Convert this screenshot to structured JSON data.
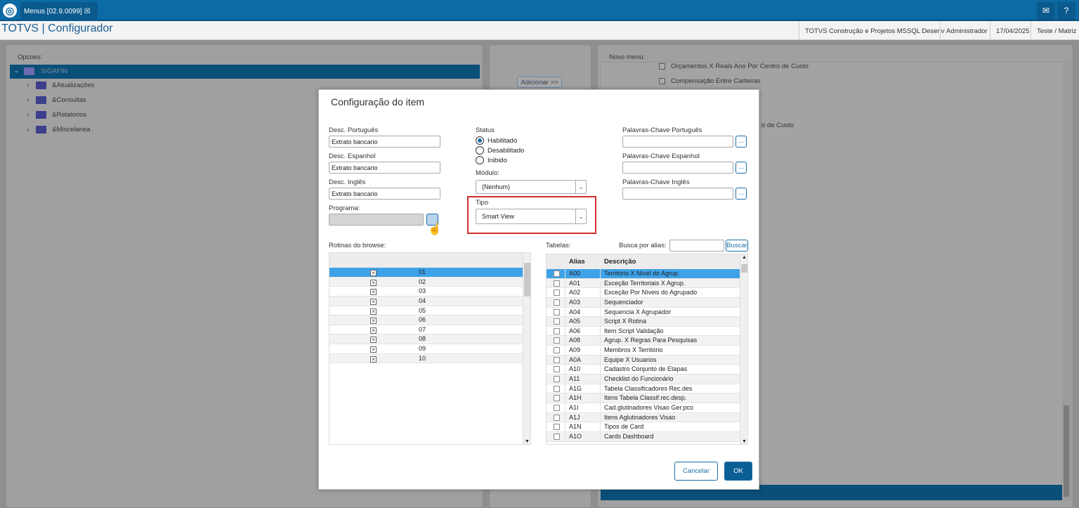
{
  "topbar": {
    "tab_label": "Menus [02.9.0099]",
    "tab_close": "☒",
    "mail_icon": "✉",
    "help_icon": "?"
  },
  "header": {
    "title": "TOTVS | Configurador",
    "environment": "TOTVS Construção e Projetos MSSQL Desenv",
    "user": "Administrador",
    "date": "17/04/2025",
    "branch": "Teste / Matriz"
  },
  "left_panel": {
    "label": "Opcoes:",
    "root": "SIGAFIN",
    "items": [
      "&Atualizações",
      "&Consultas",
      "&Relatorios",
      "&Miscelanea"
    ]
  },
  "middle_panel": {
    "add_button": "Adicionar >>"
  },
  "right_panel": {
    "label": "Novo menu:",
    "items": [
      "Orçamentos X Reais Ano Por Centro de Custo",
      "Compensação Entre Carteiras"
    ],
    "partial_text": "o de Custo"
  },
  "dialog": {
    "title": "Configuração do item",
    "desc_pt_label": "Desc. Português",
    "desc_pt": "Extrato bancario",
    "desc_es_label": "Desc. Espanhol",
    "desc_es": "Extrato bancario",
    "desc_en_label": "Desc. Inglês",
    "desc_en": "Extrato bancario",
    "programa_label": "Programa:",
    "programa": "",
    "status_label": "Status",
    "status_options": [
      "Habilitado",
      "Desabilitado",
      "Inibido"
    ],
    "status_selected": "Habilitado",
    "modulo_label": "Módulo:",
    "modulo": "(Nenhum)",
    "tipo_label": "Tipo",
    "tipo": "Smart View",
    "kw_pt_label": "Palavras-Chave Português",
    "kw_es_label": "Palavras-Chave Espanhol",
    "kw_en_label": "Palavras-Chave Inglês",
    "dots": "...",
    "rotinas_label": "Rotinas do browse:",
    "rotinas": [
      "01",
      "02",
      "03",
      "04",
      "05",
      "06",
      "07",
      "08",
      "09",
      "10"
    ],
    "tabelas_label": "Tabelas:",
    "busca_label": "Busca por alias:",
    "busca_value": "",
    "buscar_button": "Buscar",
    "tabelas_headers": [
      "Alias",
      "Descrição"
    ],
    "tabelas": [
      [
        "A00",
        "Território X Nível do Agrup."
      ],
      [
        "A01",
        "Exceção Territoriais X Agrup."
      ],
      [
        "A02",
        "Exceção Por Níveis do Agrupado"
      ],
      [
        "A03",
        "Sequenciador"
      ],
      [
        "A04",
        "Sequencia X Agrupador"
      ],
      [
        "A05",
        "Script X Rotina"
      ],
      [
        "A06",
        "Item Script Validação"
      ],
      [
        "A08",
        "Agrup. X Regras Para Pesquisas"
      ],
      [
        "A09",
        "Membros X Território"
      ],
      [
        "A0A",
        "Equipe X Usuarios"
      ],
      [
        "A10",
        "Cadastro Conjunto de Etapas"
      ],
      [
        "A11",
        "Checklist do Funcionário"
      ],
      [
        "A1G",
        "Tabela Classificadores Rec.des"
      ],
      [
        "A1H",
        "Itens Tabela Classif.rec.desp."
      ],
      [
        "A1I",
        "Cad.glutinadores Visao Ger.pco"
      ],
      [
        "A1J",
        "Itens Aglutinadores Visao"
      ],
      [
        "A1N",
        "Tipos de Card"
      ],
      [
        "A1O",
        "Cards Dashboard"
      ]
    ],
    "cancel_button": "Cancelar",
    "ok_button": "OK"
  },
  "colors": {
    "brand": "#0c6aa5",
    "highlight": "#3ea2e8",
    "annotation": "#d32f2f"
  }
}
